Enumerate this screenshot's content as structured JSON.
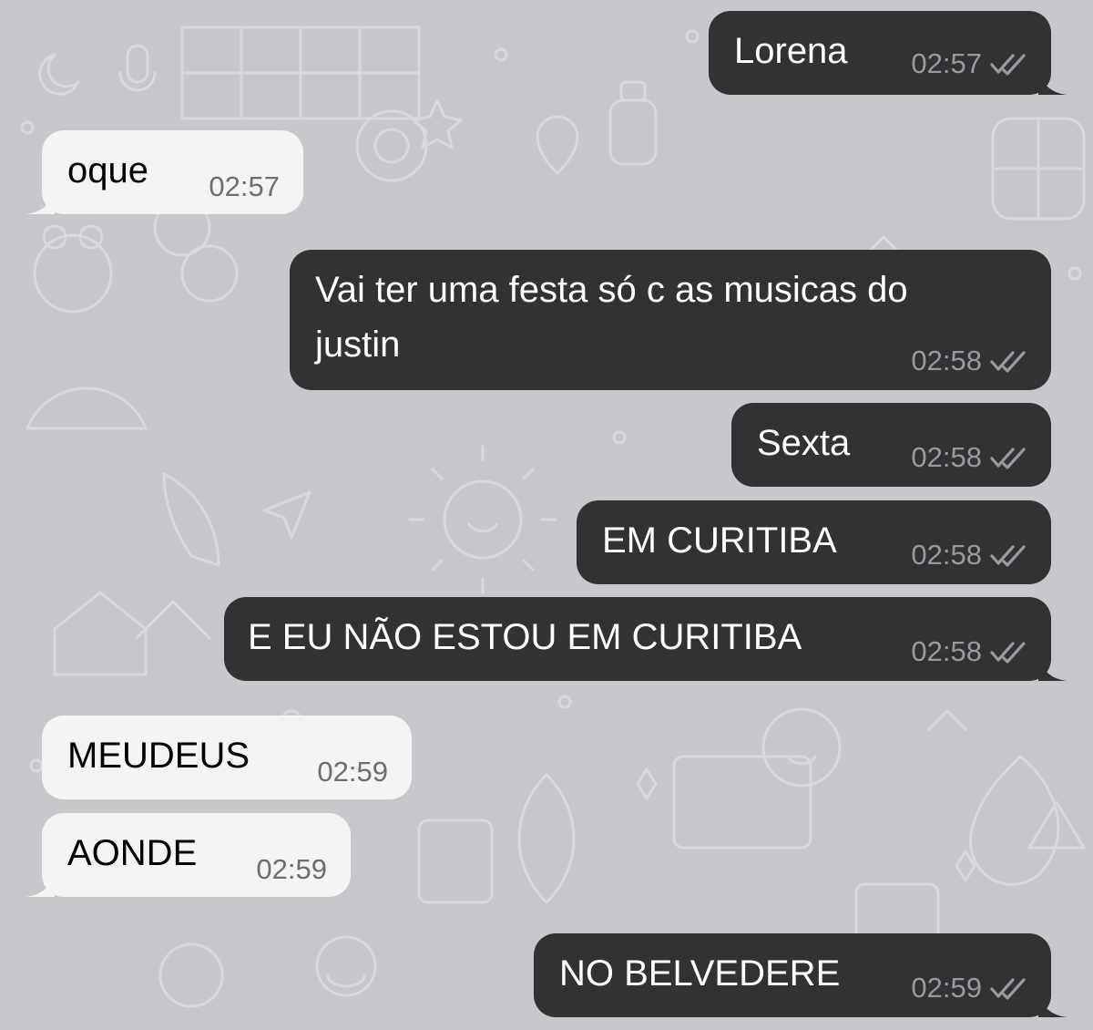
{
  "colors": {
    "outgoing_bubble": "#323234",
    "incoming_bubble": "#f4f4f5",
    "wallpaper": "#c8c8cc",
    "read_receipt": "#9a9a9e"
  },
  "messages": [
    {
      "direction": "outgoing",
      "text": "Lorena",
      "time": "02:57",
      "status": "read-double-check-icon"
    },
    {
      "direction": "incoming",
      "text": "oque",
      "time": "02:57"
    },
    {
      "direction": "outgoing",
      "text_lines": [
        "Vai ter uma festa só c as musicas do",
        "justin"
      ],
      "time": "02:58",
      "status": "read-double-check-icon"
    },
    {
      "direction": "outgoing",
      "text": "Sexta",
      "time": "02:58",
      "status": "read-double-check-icon"
    },
    {
      "direction": "outgoing",
      "text": "EM CURITIBA",
      "time": "02:58",
      "status": "read-double-check-icon"
    },
    {
      "direction": "outgoing",
      "text": "E EU NÃO ESTOU EM CURITIBA",
      "time": "02:58",
      "status": "read-double-check-icon"
    },
    {
      "direction": "incoming",
      "text": "MEUDEUS",
      "time": "02:59"
    },
    {
      "direction": "incoming",
      "text": "AONDE",
      "time": "02:59"
    },
    {
      "direction": "outgoing",
      "text": "NO BELVEDERE",
      "time": "02:59",
      "status": "read-double-check-icon"
    }
  ]
}
